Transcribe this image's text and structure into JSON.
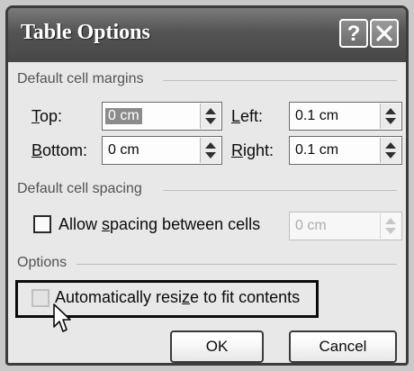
{
  "dialog": {
    "title": "Table Options",
    "help_glyph": "?",
    "icons": {
      "help": "help-icon",
      "close": "close-x-icon",
      "spinner": "spinner-arrows-icon",
      "cursor": "mouse-pointer-icon"
    }
  },
  "margins": {
    "section_label": "Default cell margins",
    "top": {
      "label_first": "T",
      "label_rest": "op:",
      "value": "0 cm"
    },
    "bottom": {
      "label_first": "B",
      "label_rest": "ottom:",
      "value": "0 cm"
    },
    "left": {
      "label_first": "L",
      "label_rest": "eft:",
      "value": "0.1 cm"
    },
    "right": {
      "label_first": "R",
      "label_rest": "ight:",
      "value": "0.1 cm"
    }
  },
  "spacing": {
    "section_label": "Default cell spacing",
    "checkbox_pre": "Allow ",
    "checkbox_key": "s",
    "checkbox_post": "pacing between cells",
    "checked": false,
    "value": "0 cm"
  },
  "options": {
    "section_label": "Options",
    "checkbox_pre": "Automatically resi",
    "checkbox_key": "z",
    "checkbox_post": "e to fit contents",
    "checked": false
  },
  "buttons": {
    "ok": "OK",
    "cancel": "Cancel"
  }
}
